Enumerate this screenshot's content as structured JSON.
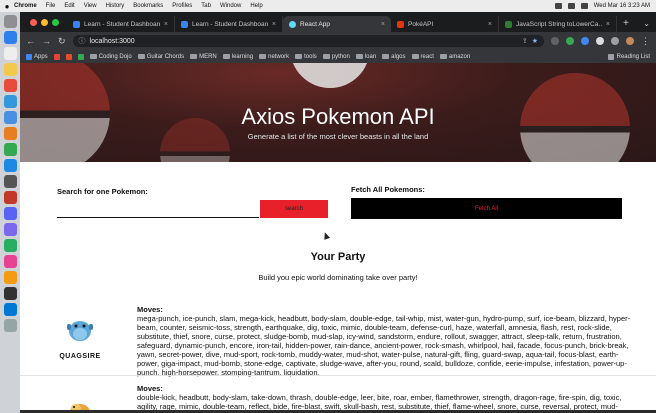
{
  "menubar": {
    "app": "Chrome",
    "items": [
      "File",
      "Edit",
      "View",
      "History",
      "Bookmarks",
      "Profiles",
      "Tab",
      "Window",
      "Help"
    ],
    "clock": "Wed Mar 16  3:23 AM"
  },
  "browser": {
    "tabs": [
      {
        "label": "Learn - Student Dashboard",
        "color": "#3b82f6"
      },
      {
        "label": "Learn - Student Dashboard",
        "color": "#3b82f6"
      },
      {
        "label": "React App",
        "color": "#61dafb",
        "active": true
      },
      {
        "label": "PokéAPI",
        "color": "#e3350d"
      },
      {
        "label": "JavaScript String toLowerCa…",
        "color": "#2e7d32"
      }
    ],
    "url": "localhost:3000",
    "bookmarks": [
      "Apps",
      "Coding Dojo",
      "Guitar Chords",
      "MERN",
      "learning",
      "network",
      "tools",
      "python",
      "loan",
      "algos",
      "react",
      "amazon"
    ],
    "reading_list": "Reading List"
  },
  "hero": {
    "title": "Axios Pokemon API",
    "subtitle": "Generate a list of the most clever beasts in all the land"
  },
  "search": {
    "label": "Search for one Pokemon:",
    "value": "",
    "button": "search"
  },
  "fetch": {
    "label": "Fetch All Pokemons:",
    "button": "Fetch All"
  },
  "party": {
    "title": "Your Party",
    "subtitle": "Build you epic world dominating take over party!",
    "members": [
      {
        "name": "QUAGSIRE",
        "moves_label": "Moves:",
        "moves": "mega-punch, ice-punch, slam, mega-kick, headbutt, body-slam, double-edge, tail-whip, mist, water-gun, hydro-pump, surf, ice-beam, blizzard, hyper-beam, counter, seismic-toss, strength, earthquake, dig, toxic, mimic, double-team, defense-curl, haze, waterfall, amnesia, flash, rest, rock-slide, substitute, thief, snore, curse, protect, sludge-bomb, mud-slap, icy-wind, sandstorm, endure, rollout, swagger, attract, sleep-talk, return, frustration, safeguard, dynamic-punch, encore, iron-tail, hidden-power, rain-dance, ancient-power, rock-smash, whirlpool, hail, facade, focus-punch, brick-break, yawn, secret-power, dive, mud-sport, rock-tomb, muddy-water, mud-shot, water-pulse, natural-gift, fling, guard-swap, aqua-tail, focus-blast, earth-power, giga-impact, mud-bomb, stone-edge, captivate, sludge-wave, after-you, round, scald, bulldoze, confide, eerie-impulse, infestation, power-up-punch, high-horsepower, stomping-tantrum, liquidation,"
      },
      {
        "name": "",
        "moves_label": "Moves:",
        "moves": "double-kick, headbutt, body-slam, take-down, thrash, double-edge, leer, bite, roar, ember, flamethrower, strength, dragon-rage, fire-spin, dig, toxic, agility, rage, mimic, double-team, reflect, bide, fire-blast, swift, skull-bash, rest, substitute, thief, flame-wheel, snore, curse, reversal, protect, mud-"
      }
    ]
  }
}
